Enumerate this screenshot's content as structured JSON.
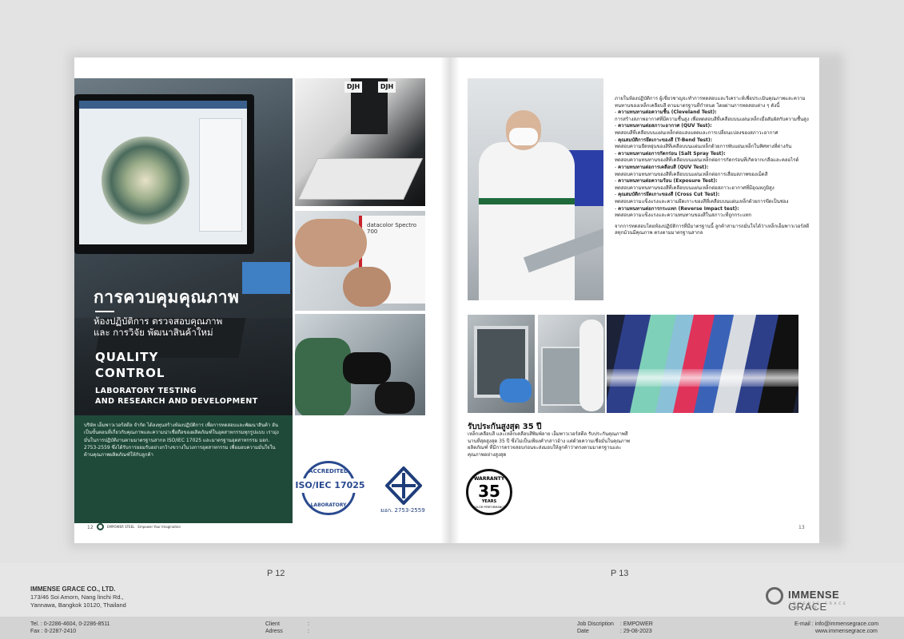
{
  "left_page": {
    "thai_title": "การควบคุมคุณภาพ",
    "thai_subtitle_1": "ห้องปฏิบัติการ ตรวจสอบคุณภาพ",
    "thai_subtitle_2": "และ การวิจัย พัฒนาสินค้าใหม่",
    "en_title_1": "QUALITY",
    "en_title_2": "CONTROL",
    "en_subtitle_1": "LABORATORY TESTING",
    "en_subtitle_2": "AND RESEARCH AND DEVELOPMENT",
    "body_text": "บริษัท เอ็มพาวเวอร์สตีล จำกัด ได้ลงทุนสร้างห้องปฏิบัติการ เพื่อการทดสอบและพัฒนาสินค้า อันเป็นขั้นตอนที่เกี่ยวกับคุณภาพและความน่าเชื่อถือของผลิตภัณฑ์ในอุตสาหกรรมทุกรูปแบบ เรามุ่งมั่นในการปฏิบัติงานตามมาตรฐานสากล ISO/IEC 17025 และมาตรฐานอุตสาหกรรม มอก. 2753-2559 ซึ่งได้รับการยอมรับอย่างกว้างขวางในวงการอุตสาหกรรม เพื่อมอบความมั่นใจในด้านคุณภาพผลิตภัณฑ์ให้กับลูกค้า",
    "photo_label_1": "DJH",
    "photo_label_2": "DJH",
    "device_label": "datacolor Spectro 700",
    "cert_top": "ACCREDITED",
    "cert_main": "ISO/IEC 17025",
    "cert_bottom": "LABORATORY",
    "tis_label": "มอก. 2753-2559",
    "page_number": "12",
    "footer_brand": "EMPOWER STEEL",
    "footer_tagline": "Empower Your Imagination"
  },
  "right_page": {
    "intro": "ภายในห้องปฏิบัติการ ผู้เชี่ยวชาญจะทำการทดสอบและวิเคราะห์เพื่อประเมินคุณภาพและความทนทานของเหล็กเคลือบสี ตามมาตรฐานที่กำหนด โดยผ่านการทดสอบต่าง ๆ ดังนี้",
    "tests": [
      {
        "name": "ความทนทานต่อความชื้น (Cleveland Test):",
        "desc": "การสร้างสภาพอากาศที่มีความชื้นสูง เพื่อทดสอบสีที่เคลือบบนแผ่นเหล็กเมื่อสัมผัสกับความชื้นสูง"
      },
      {
        "name": "ความทนทานต่อสภาวะอากาศ (QUV Test):",
        "desc": "ทดสอบสีที่เคลือบบนแผ่นเหล็กต่อแสงแดดและการเปลี่ยนแปลงของสภาวะอากาศ"
      },
      {
        "name": "คุณสมบัติการยึดเกาะของสี (T-Bend Test):",
        "desc": "ทดสอบความยืดหยุ่นของสีที่เคลือบบนแผ่นเหล็กด้วยการพับแผ่นเหล็กในทิศทางที่ต่างกัน"
      },
      {
        "name": "ความทนทานต่อการกัดกร่อน (Salt Spray Test):",
        "desc": "ทดสอบความทนทานของสีที่เคลือบบนแผ่นเหล็กต่อการกัดกร่อนที่เกิดจากเกลือและคลอไรด์"
      },
      {
        "name": "ความทนทานต่อการเคลือบสี (QUV Test):",
        "desc": "ทดสอบความทนทานของสีที่เคลือบบนแผ่นเหล็กต่อการเสื่อมสภาพของเม็ดสี"
      },
      {
        "name": "ความทนทานต่อความร้อน (Exposure Test):",
        "desc": "ทดสอบความทนทานของสีที่เคลือบบนแผ่นเหล็กต่อสภาวะอากาศที่มีอุณหภูมิสูง"
      },
      {
        "name": "คุณสมบัติการยึดเกาะของสี (Cross Cut Test):",
        "desc": "ทดสอบความแข็งแรงและความยึดเกาะของสีที่เคลือบบนแผ่นเหล็กด้วยการขีดเป็นช่อง"
      },
      {
        "name": "ความทนทานต่อการกระแทก (Reverse Impact test):",
        "desc": "ทดสอบความแข็งแรงและความทนทานของสีในสภาวะที่ถูกกระแทก"
      }
    ],
    "conclusion": "จากการทดสอบโดยห้องปฏิบัติการที่มีมาตรฐานนี้ ลูกค้าสามารถมั่นใจได้ว่าเหล็กเอ็มพาวเวอร์สตีลทุกม้วนมีคุณภาพ ตรงตามมาตรฐานสากล",
    "warranty_title": "รับประกันสูงสุด 35 ปี",
    "warranty_text": "เหล็กเคลือบสี และเหล็กเคลือบสีพิมพ์ลาย เอ็มพาวเวอร์สตีล รับประกันคุณภาพสีนานที่สุดสูงสุด 35 ปี ซึ่งไม่เป็นเพียงคำกล่าวอ้าง แต่ด้วยความเชื่อมั่นในคุณภาพผลิตภัณฑ์ ที่มีการตรวจสอบก่อนจะส่งมอบให้ลูกค้าว่าตรงตามมาตรฐานและคุณภาพอย่างสูงสุด",
    "badge_top": "WARRANTY",
    "badge_number": "35",
    "badge_years": "YEARS",
    "badge_bottom": "COLOR PERFORMANCE",
    "page_number": "13"
  },
  "labels": {
    "left": "P 12",
    "right": "P 13"
  },
  "company": {
    "name": "IMMENSE GRACE CO., LTD.",
    "address_1": "173/46 Soi Amorn, Nang linchi Rd.,",
    "address_2": "Yannawa, Bangkok 10120, Thailand"
  },
  "brand": {
    "word_1": "IMMENSE",
    "word_2": "GRACE",
    "tagline": "IMMENSE GRACE CO.,LTD."
  },
  "footer": {
    "tel": "Tel. :  0-2286-4604, 0-2286-8511",
    "fax": "Fax :  0-2287-2410",
    "client_label": "Client",
    "client_value": ":",
    "address_label": "Adress",
    "address_value": ":",
    "job_label": "Job Discription",
    "job_value": ":  EMPOWER",
    "date_label": "Date",
    "date_value": ":  29-08-2023",
    "email": "E-mail :  info@immensegrace.com",
    "web": "www.immensegrace.com"
  },
  "colors": {
    "dark_green": "#1f4a3a",
    "navy": "#2a4a8f",
    "footer_bar": "#d3d3d3",
    "panel_colors": [
      "#2e3f8a",
      "#7fd0b8",
      "#8ac0d8",
      "#e0335a",
      "#3a63b8",
      "#d8dbe0",
      "#111111"
    ]
  }
}
